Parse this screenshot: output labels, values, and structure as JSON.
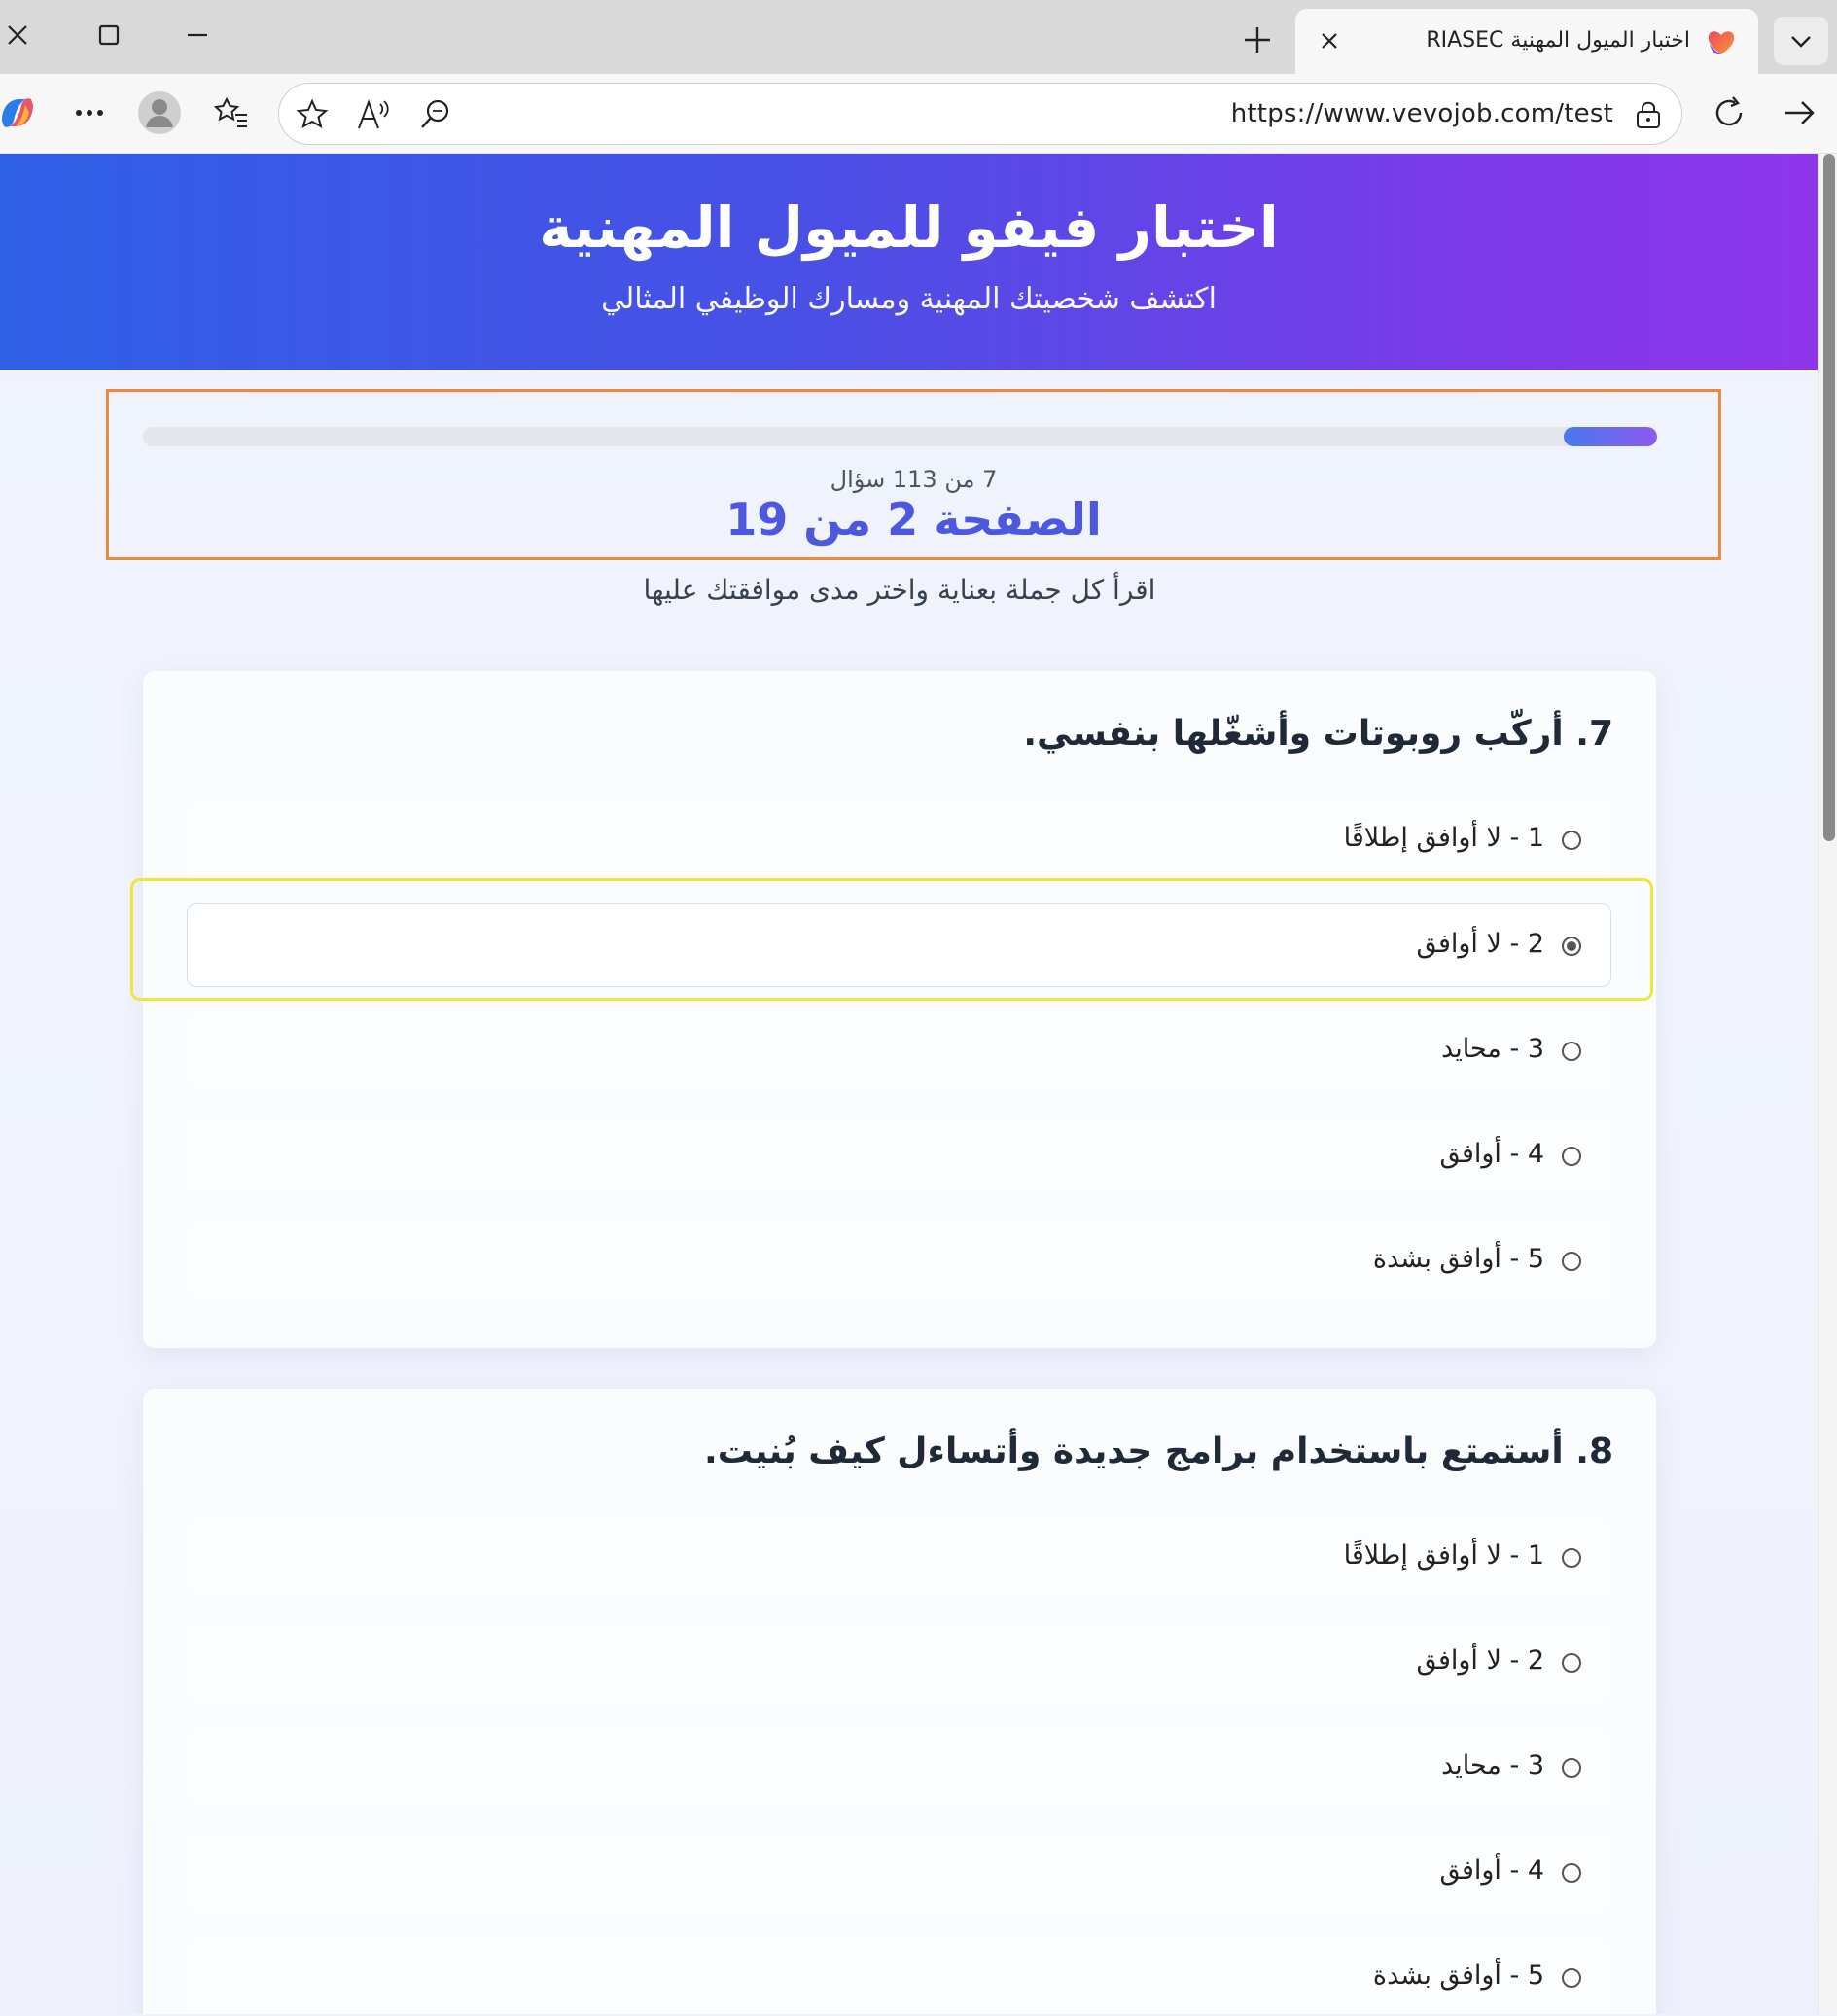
{
  "browser": {
    "tab": {
      "title": "اختبار الميول المهنية RIASEC"
    },
    "url": "https://www.vevojob.com/test"
  },
  "header": {
    "title": "اختبار فيفو للميول المهنية",
    "subtitle": "اكتشف شخصيتك المهنية ومسارك الوظيفي المثالي"
  },
  "progress": {
    "question_count": "7 من 113 سؤال",
    "page_label": "الصفحة 2 من 19",
    "fraction": 0.0619
  },
  "instructions": "اقرأ كل جملة بعناية واختر مدى موافقتك عليها",
  "questions": [
    {
      "text": "7. أركّب روبوتات وأشغّلها بنفسي.",
      "selected": 1,
      "options": [
        {
          "label": "1 - لا أوافق إطلاقًا"
        },
        {
          "label": "2 - لا أوافق"
        },
        {
          "label": "3 - محايد"
        },
        {
          "label": "4 - أوافق"
        },
        {
          "label": "5 - أوافق بشدة"
        }
      ]
    },
    {
      "text": "8. أستمتع باستخدام برامج جديدة وأتساءل كيف بُنيت.",
      "selected": null,
      "options": [
        {
          "label": "1 - لا أوافق إطلاقًا"
        },
        {
          "label": "2 - لا أوافق"
        },
        {
          "label": "3 - محايد"
        },
        {
          "label": "4 - أوافق"
        },
        {
          "label": "5 - أوافق بشدة"
        }
      ]
    }
  ],
  "icons": {
    "window_close": "close-icon",
    "window_maximize": "maximize-icon",
    "window_minimize": "minimize-icon",
    "new_tab": "plus-icon",
    "tab_list": "chevron-down-icon",
    "copilot": "copilot-icon",
    "more": "more-icon",
    "profile": "avatar",
    "favorites": "favorites-icon",
    "add_favorite": "star-icon",
    "read_aloud": "read-aloud-icon",
    "find": "search-icon",
    "lock": "lock-icon",
    "refresh": "refresh-icon",
    "forward": "forward-arrow-icon"
  },
  "colors": {
    "hero_start": "#2f5fe6",
    "hero_end": "#8f35ec",
    "accent": "#4d57e0",
    "annotation_orange": "#f0883b",
    "annotation_yellow": "#f1e43a"
  }
}
